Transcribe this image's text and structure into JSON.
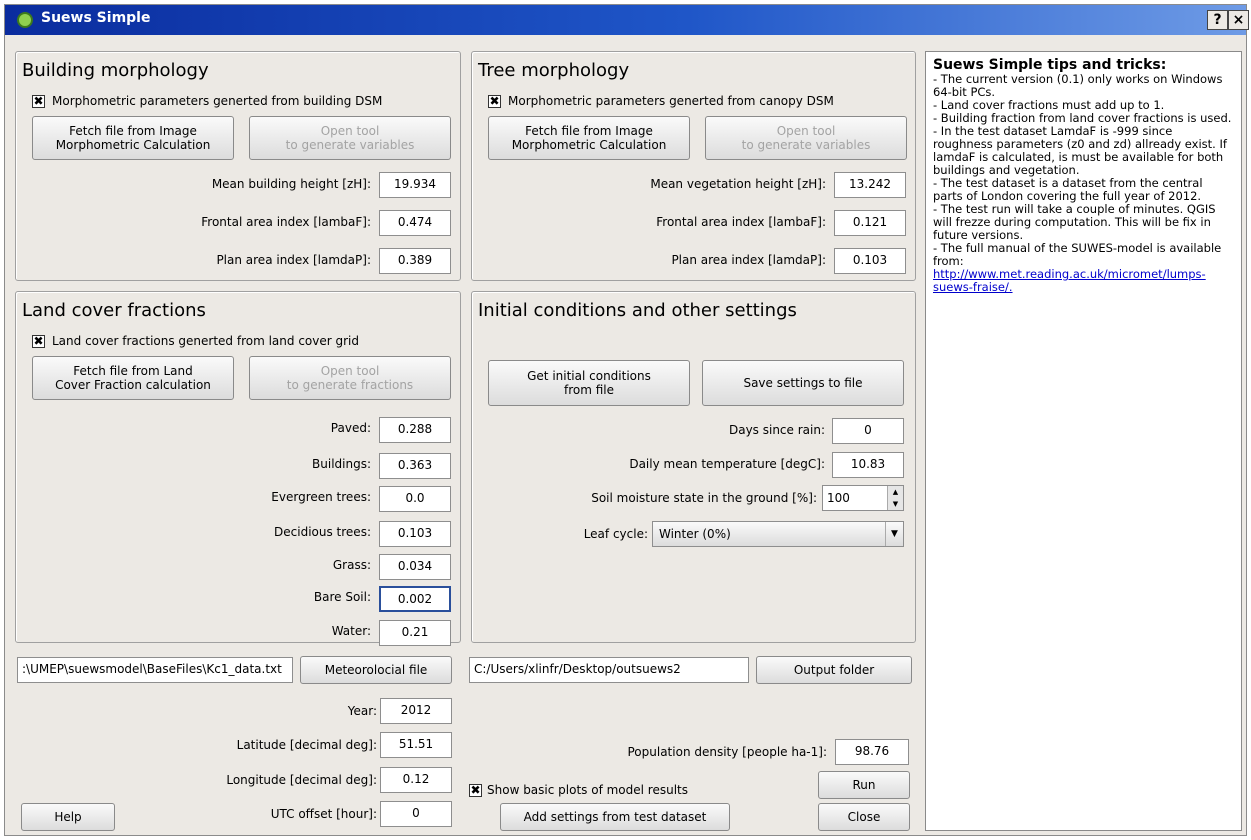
{
  "window": {
    "title": "Suews Simple",
    "help_label": "?",
    "close_label": "×"
  },
  "building": {
    "title": "Building morphology",
    "check_label": "Morphometric parameters generted from building DSM",
    "fetch_label": "Fetch file from Image\nMorphometric Calculation",
    "open_label": "Open tool\nto generate variables",
    "height_label": "Mean building height [zH]:",
    "height_value": "19.934",
    "frontal_label": "Frontal area index [lambaF]:",
    "frontal_value": "0.474",
    "plan_label": "Plan area index [lamdaP]:",
    "plan_value": "0.389"
  },
  "tree": {
    "title": "Tree morphology",
    "check_label": "Morphometric parameters generted from canopy DSM",
    "fetch_label": "Fetch file from Image\nMorphometric Calculation",
    "open_label": "Open tool\nto generate variables",
    "height_label": "Mean vegetation height [zH]:",
    "height_value": "13.242",
    "frontal_label": "Frontal area index [lambaF]:",
    "frontal_value": "0.121",
    "plan_label": "Plan area index [lamdaP]:",
    "plan_value": "0.103"
  },
  "landcover": {
    "title": "Land cover fractions",
    "check_label": "Land cover fractions generted from land cover grid",
    "fetch_label": "Fetch file from Land\nCover Fraction calculation",
    "open_label": "Open tool\nto generate fractions",
    "rows": [
      {
        "label": "Paved:",
        "value": "0.288"
      },
      {
        "label": "Buildings:",
        "value": "0.363"
      },
      {
        "label": "Evergreen trees:",
        "value": "0.0"
      },
      {
        "label": "Decidious trees:",
        "value": "0.103"
      },
      {
        "label": "Grass:",
        "value": "0.034"
      },
      {
        "label": "Bare Soil:",
        "value": "0.002"
      },
      {
        "label": "Water:",
        "value": "0.21"
      }
    ]
  },
  "initial": {
    "title": "Initial conditions and other settings",
    "get_label": "Get initial conditions\nfrom file",
    "save_label": "Save settings to file",
    "rain_label": "Days since rain:",
    "rain_value": "0",
    "temp_label": "Daily mean temperature [degC]:",
    "temp_value": "10.83",
    "soil_label": "Soil moisture state in the ground [%]:",
    "soil_value": "100",
    "leaf_label": "Leaf cycle:",
    "leaf_value": "Winter (0%)"
  },
  "files": {
    "met_path": ":\\UMEP\\suewsmodel\\BaseFiles\\Kc1_data.txt",
    "met_button": "Meteorolocial file",
    "out_path": "C:/Users/xlinfr/Desktop/outsuews2",
    "out_button": "Output folder"
  },
  "site": {
    "year_label": "Year:",
    "year_value": "2012",
    "lat_label": "Latitude [decimal deg]:",
    "lat_value": "51.51",
    "lon_label": "Longitude [decimal deg]:",
    "lon_value": "0.12",
    "utc_label": "UTC offset [hour]:",
    "utc_value": "0",
    "pop_label": "Population density [people ha-1]:",
    "pop_value": "98.76"
  },
  "bottom": {
    "help_label": "Help",
    "plots_label": "Show basic plots of model results",
    "run_label": "Run",
    "test_label": "Add settings from test dataset",
    "close_label": "Close"
  },
  "tips": {
    "title": "Suews Simple tips and tricks:",
    "lines": [
      "- The current version (0.1) only works on Windows 64-bit PCs.",
      "- Land cover fractions must add up to 1.",
      "- Building fraction from land cover fractions is used.",
      "- In the test dataset LamdaF is -999 since roughness parameters (z0 and zd) allready exist. If lamdaF is calculated, is must be available for both buildings and vegetation.",
      "- The test dataset is a dataset from the central parts of London covering the full year of 2012.",
      "- The test run will take a couple of minutes. QGIS will frezze during computation. This will be fix in future versions.",
      "- The full manual of the SUWES-model is available from:"
    ],
    "link": "http://www.met.reading.ac.uk/micromet/lumps-suews-fraise/."
  },
  "icons": {
    "check": "✖",
    "spin_up": "▲",
    "spin_down": "▼",
    "combo_arrow": "▼"
  }
}
